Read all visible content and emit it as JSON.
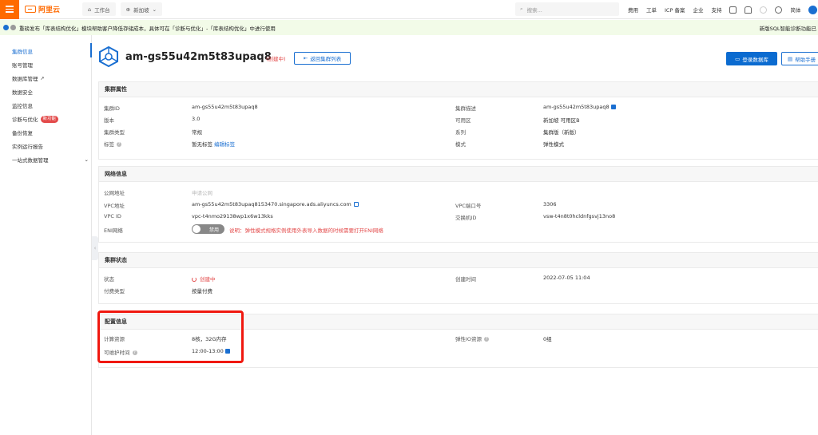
{
  "topbar": {
    "logo_text": "阿里云",
    "workbench": "工作台",
    "region": "新加坡",
    "search_placeholder": "搜索...",
    "links": [
      "费用",
      "工单",
      "ICP 备案",
      "企业",
      "支持"
    ],
    "lang": "简体"
  },
  "banner": {
    "text": "重磅发布「库表结构优化」模块帮助客户降低存储成本，具体可在「诊断与优化」-「库表结构优化」中进行使用",
    "right_text": "新版SQL智能诊断功能已"
  },
  "sidebar": {
    "items": [
      {
        "label": "集群信息"
      },
      {
        "label": "账号管理"
      },
      {
        "label": "数据库管理"
      },
      {
        "label": "数据安全"
      },
      {
        "label": "监控信息"
      },
      {
        "label": "诊断与优化",
        "badge": "新功能"
      },
      {
        "label": "备份恢复"
      },
      {
        "label": "实例运行报告"
      },
      {
        "label": "一站式数据管理"
      }
    ]
  },
  "header": {
    "title": "am-gs55u42m5t83upaq8",
    "status_tag": "(创建中)",
    "back_button": "返回集群列表",
    "login_button": "登录数据库",
    "help_button": "帮助手册"
  },
  "cluster_props": {
    "heading": "集群属性",
    "cluster_id_label": "集群ID",
    "cluster_id": "am-gs55u42m5t83upaq8",
    "cluster_desc_label": "集群描述",
    "cluster_desc": "am-gs55u42m5t83upaq8",
    "version_label": "版本",
    "version": "3.0",
    "zone_label": "可用区",
    "zone": "新加坡 可用区B",
    "type_label": "集群类型",
    "type": "常规",
    "series_label": "系列",
    "series": "集群版（新版）",
    "tags_label": "标签",
    "tags_value": "暂无标签",
    "tags_edit": "编辑标签",
    "mode_label": "模式",
    "mode": "弹性模式"
  },
  "network": {
    "heading": "网络信息",
    "public_label": "公网地址",
    "public_value": "申请公网",
    "vpc_addr_label": "VPC地址",
    "vpc_addr": "am-gs55u42m5t83upaq8153470.singapore.ads.aliyuncs.com",
    "vpc_port_label": "VPC端口号",
    "vpc_port": "3306",
    "vpc_id_label": "VPC ID",
    "vpc_id": "vpc-t4nmo29138wp1x6w13kks",
    "vswitch_label": "交换机ID",
    "vswitch": "vsw-t4n8t0hcldnfgsvj13no8",
    "eni_label": "ENI网络",
    "eni_toggle": "禁用",
    "eni_note": "说明：弹性模式规格实例使用外表导入数据的时候需要打开ENI网络"
  },
  "status": {
    "heading": "集群状态",
    "state_label": "状态",
    "state": "创建中",
    "created_label": "创建时间",
    "created": "2022-07-05 11:04",
    "billing_label": "付费类型",
    "billing": "按量付费"
  },
  "config": {
    "heading": "配置信息",
    "compute_label": "计算资源",
    "compute": "8核，32G内存",
    "elastic_io_label": "弹性IO资源",
    "elastic_io": "0组",
    "maint_label": "可维护时间",
    "maint": "12:00-13:00"
  },
  "colors": {
    "brand_orange": "#ff6a00",
    "primary_blue": "#0b6bd0",
    "warning_red": "#e34a4a",
    "highlight_red": "#f0180f"
  }
}
